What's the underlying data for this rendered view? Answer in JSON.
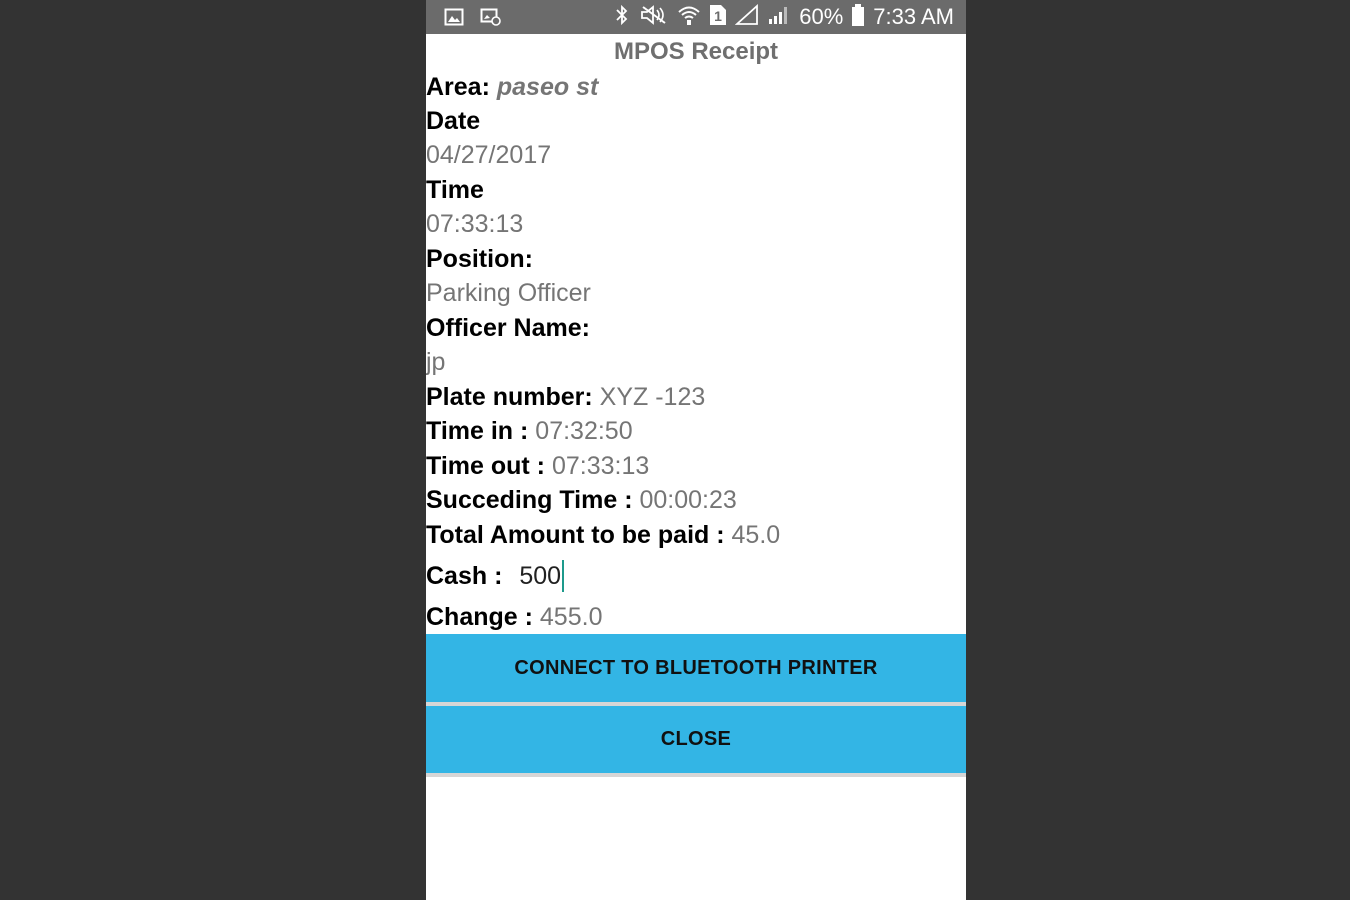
{
  "status_bar": {
    "battery_percent": "60%",
    "time": "7:33 AM",
    "sim_slot": "1",
    "icons": [
      "image-icon",
      "gallery-settings-icon",
      "bluetooth-icon",
      "mute-icon",
      "wifi-icon",
      "sim-icon",
      "no-signal-icon",
      "signal-icon",
      "battery-icon"
    ]
  },
  "receipt": {
    "title": "MPOS Receipt",
    "area_label": "Area:",
    "area_value": "paseo st",
    "date_label": "Date",
    "date_value": "04/27/2017",
    "time_label": "Time",
    "time_value": "07:33:13",
    "position_label": "Position:",
    "position_value": "Parking Officer",
    "officer_label": "Officer Name:",
    "officer_value": "jp",
    "plate_label": "Plate number:",
    "plate_value": "XYZ -123",
    "time_in_label": "Time in :",
    "time_in_value": "07:32:50",
    "time_out_label": "Time out :",
    "time_out_value": "07:33:13",
    "succeeding_label": "Succeding Time :",
    "succeeding_value": "00:00:23",
    "total_label": "Total Amount to be paid :",
    "total_value": "45.0",
    "cash_label": "Cash :",
    "cash_value": "500",
    "change_label": "Change :",
    "change_value": "455.0"
  },
  "buttons": {
    "connect_label": "CONNECT TO BLUETOOTH PRINTER",
    "close_label": "CLOSE"
  },
  "colors": {
    "button_bg": "#33b5e5",
    "status_bar_bg": "#6b6b6b",
    "cursor": "#1d9a8c"
  }
}
